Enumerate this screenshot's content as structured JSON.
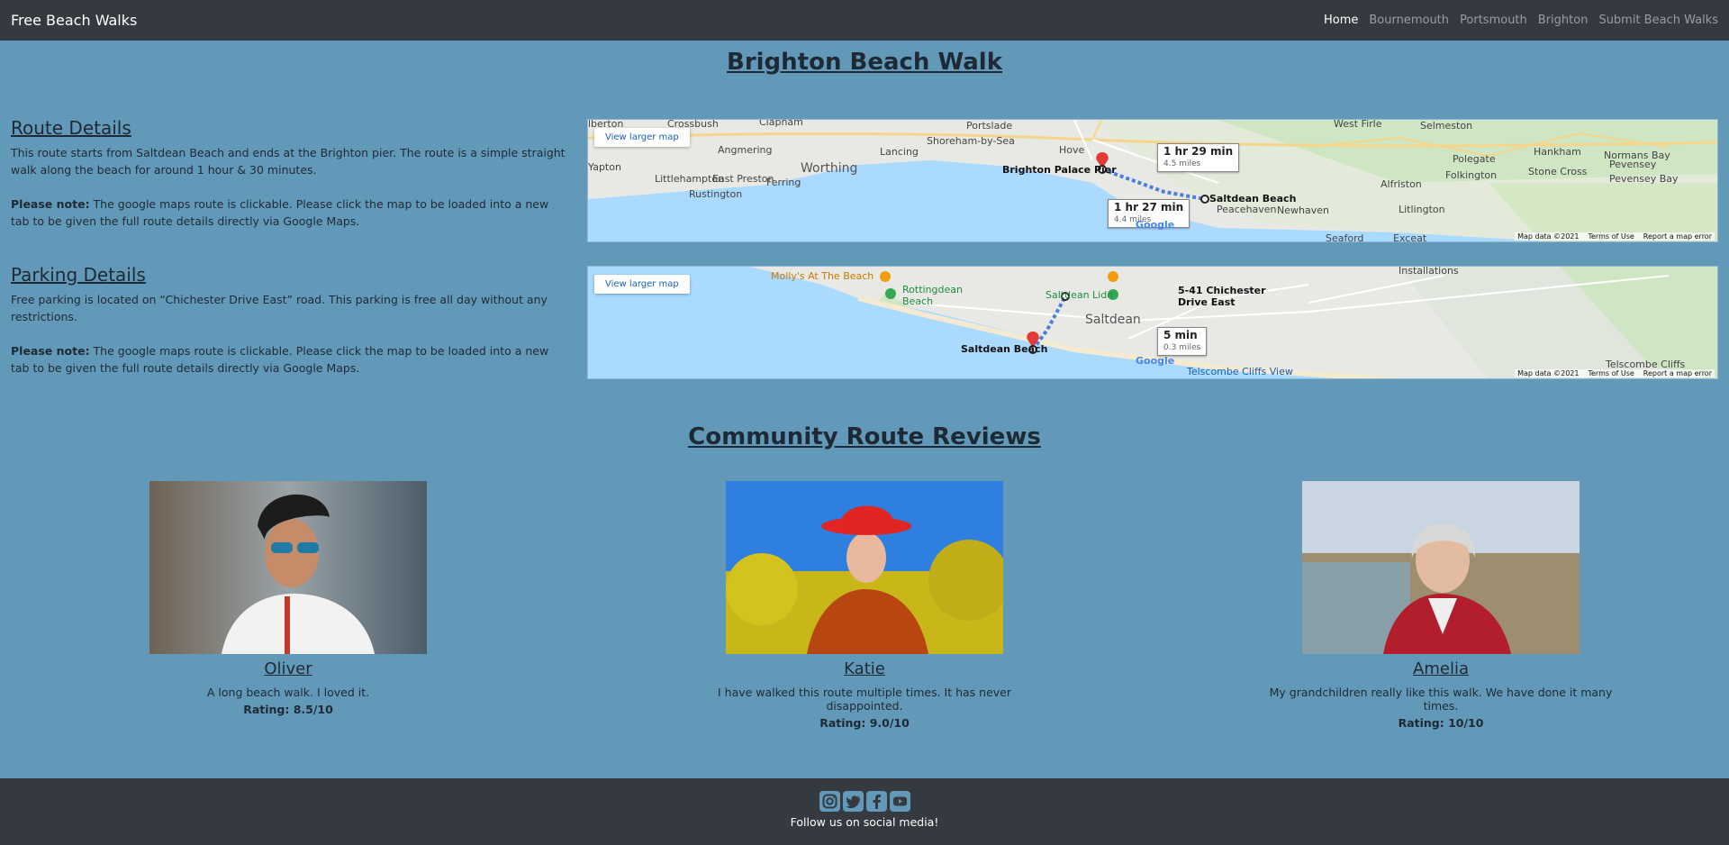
{
  "nav": {
    "brand": "Free Beach Walks",
    "links": [
      "Home",
      "Bournemouth",
      "Portsmouth",
      "Brighton",
      "Submit Beach Walks"
    ]
  },
  "page_title": "Brighton Beach Walk",
  "route": {
    "heading": "Route Details",
    "text": "This route starts from Saltdean Beach and ends at the Brighton pier. The route is a simple straight walk along the beach for around 1 hour & 30 minutes.",
    "note_label": "Please note:",
    "note_text": " The google maps route is clickable. Please click the map to be loaded into a new tab to be given the full route details directly via Google Maps."
  },
  "parking": {
    "heading": "Parking Details",
    "text": "Free parking is located on “Chichester Drive East” road. This parking is free all day without any restrictions.",
    "note_label": "Please note:",
    "note_text": " The google maps route is clickable. Please click the map to be loaded into a new tab to be given the full route details directly via Google Maps."
  },
  "map1": {
    "button": "View larger map",
    "footer": [
      "Map data ©2021",
      "Terms of Use",
      "Report a map error"
    ],
    "places": [
      "Crossbush",
      "Clapham",
      "Portslade",
      "West Firle",
      "Selmeston",
      "Angmering",
      "Lancing",
      "Shoreham-by-Sea",
      "Hove",
      "Hankham",
      "Normans Bay",
      "Polegate",
      "Worthing",
      "Littlehampton",
      "East Preston",
      "Ferring",
      "Rustington",
      "Brighton Palace Pier",
      "Saltdean Beach",
      "Peacehaven",
      "Newhaven",
      "Alfriston",
      "Folkington",
      "Stone Cross",
      "Pevensey",
      "Pevensey Bay",
      "Litlington",
      "Seaford",
      "Exceat",
      "lberton",
      "Yapton"
    ],
    "callout_a": {
      "time": "1 hr 29 min",
      "dist": "4.5 miles"
    },
    "callout_b": {
      "time": "1 hr 27 min",
      "dist": "4.4 miles"
    },
    "logo": "Google"
  },
  "map2": {
    "button": "View larger map",
    "footer": [
      "Map data ©2021",
      "Terms of Use",
      "Report a map error"
    ],
    "places": [
      "Molly's At The Beach",
      "Rottingdean Beach",
      "Saltdean Lido",
      "5-41 Chichester Drive East",
      "Saltdean",
      "Saltdean Beach",
      "Installations",
      "Telscombe Cliffs",
      "Telscombe Cliffs View"
    ],
    "callout": {
      "time": "5 min",
      "dist": "0.3 miles"
    },
    "logo": "Google"
  },
  "reviews_title": "Community Route Reviews",
  "reviews": [
    {
      "name": "Oliver",
      "text": "A long beach walk. I loved it.",
      "rating": "Rating: 8.5/10"
    },
    {
      "name": "Katie",
      "text": "I have walked this route multiple times. It has never disappointed.",
      "rating": "Rating: 9.0/10"
    },
    {
      "name": "Amelia",
      "text": "My grandchildren really like this walk. We have done it many times.",
      "rating": "Rating: 10/10"
    }
  ],
  "footer": {
    "icons": [
      "instagram-icon",
      "twitter-icon",
      "facebook-icon",
      "youtube-icon"
    ],
    "text": "Follow us on social media!"
  }
}
